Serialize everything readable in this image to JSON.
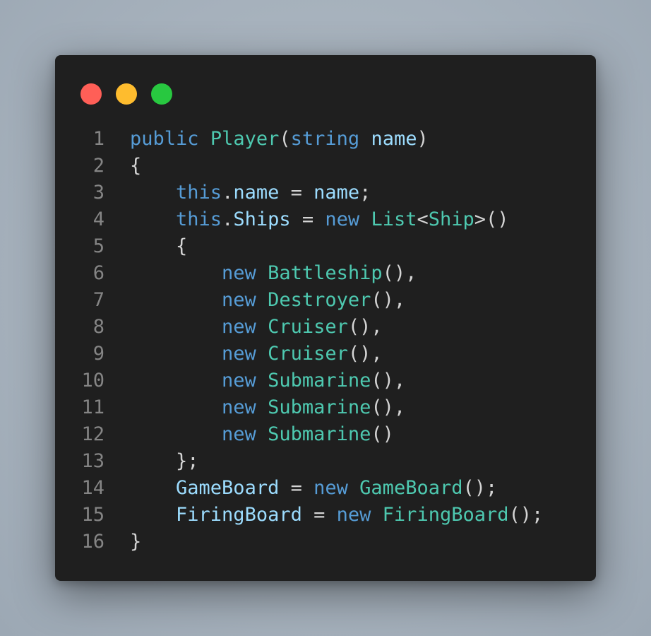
{
  "window": {
    "controls": [
      {
        "name": "close",
        "color": "#ff5f57"
      },
      {
        "name": "minimize",
        "color": "#febc2e"
      },
      {
        "name": "maximize",
        "color": "#28c840"
      }
    ]
  },
  "theme": {
    "background": "#1f1f1f",
    "keyword": "#569cd6",
    "type": "#4ec9b0",
    "variable": "#9cdcfe",
    "punctuation": "#d4d4d4",
    "line_number": "#858585"
  },
  "code": {
    "language": "csharp",
    "lines": [
      {
        "num": "1",
        "tokens": [
          [
            "keyword",
            "public"
          ],
          [
            "punct",
            " "
          ],
          [
            "type",
            "Player"
          ],
          [
            "punct",
            "("
          ],
          [
            "keyword",
            "string"
          ],
          [
            "punct",
            " "
          ],
          [
            "variable",
            "name"
          ],
          [
            "punct",
            ")"
          ]
        ]
      },
      {
        "num": "2",
        "tokens": [
          [
            "punct",
            "{"
          ]
        ]
      },
      {
        "num": "3",
        "tokens": [
          [
            "punct",
            "    "
          ],
          [
            "keyword",
            "this"
          ],
          [
            "punct",
            "."
          ],
          [
            "variable",
            "name"
          ],
          [
            "punct",
            " = "
          ],
          [
            "variable",
            "name"
          ],
          [
            "punct",
            ";"
          ]
        ]
      },
      {
        "num": "4",
        "tokens": [
          [
            "punct",
            "    "
          ],
          [
            "keyword",
            "this"
          ],
          [
            "punct",
            "."
          ],
          [
            "variable",
            "Ships"
          ],
          [
            "punct",
            " = "
          ],
          [
            "keyword",
            "new"
          ],
          [
            "punct",
            " "
          ],
          [
            "type",
            "List"
          ],
          [
            "punct",
            "<"
          ],
          [
            "type",
            "Ship"
          ],
          [
            "punct",
            ">()"
          ]
        ]
      },
      {
        "num": "5",
        "tokens": [
          [
            "punct",
            "    {"
          ]
        ]
      },
      {
        "num": "6",
        "tokens": [
          [
            "punct",
            "        "
          ],
          [
            "keyword",
            "new"
          ],
          [
            "punct",
            " "
          ],
          [
            "type",
            "Battleship"
          ],
          [
            "punct",
            "(),"
          ]
        ]
      },
      {
        "num": "7",
        "tokens": [
          [
            "punct",
            "        "
          ],
          [
            "keyword",
            "new"
          ],
          [
            "punct",
            " "
          ],
          [
            "type",
            "Destroyer"
          ],
          [
            "punct",
            "(),"
          ]
        ]
      },
      {
        "num": "8",
        "tokens": [
          [
            "punct",
            "        "
          ],
          [
            "keyword",
            "new"
          ],
          [
            "punct",
            " "
          ],
          [
            "type",
            "Cruiser"
          ],
          [
            "punct",
            "(),"
          ]
        ]
      },
      {
        "num": "9",
        "tokens": [
          [
            "punct",
            "        "
          ],
          [
            "keyword",
            "new"
          ],
          [
            "punct",
            " "
          ],
          [
            "type",
            "Cruiser"
          ],
          [
            "punct",
            "(),"
          ]
        ]
      },
      {
        "num": "10",
        "tokens": [
          [
            "punct",
            "        "
          ],
          [
            "keyword",
            "new"
          ],
          [
            "punct",
            " "
          ],
          [
            "type",
            "Submarine"
          ],
          [
            "punct",
            "(),"
          ]
        ]
      },
      {
        "num": "11",
        "tokens": [
          [
            "punct",
            "        "
          ],
          [
            "keyword",
            "new"
          ],
          [
            "punct",
            " "
          ],
          [
            "type",
            "Submarine"
          ],
          [
            "punct",
            "(),"
          ]
        ]
      },
      {
        "num": "12",
        "tokens": [
          [
            "punct",
            "        "
          ],
          [
            "keyword",
            "new"
          ],
          [
            "punct",
            " "
          ],
          [
            "type",
            "Submarine"
          ],
          [
            "punct",
            "()"
          ]
        ]
      },
      {
        "num": "13",
        "tokens": [
          [
            "punct",
            "    };"
          ]
        ]
      },
      {
        "num": "14",
        "tokens": [
          [
            "punct",
            "    "
          ],
          [
            "variable",
            "GameBoard"
          ],
          [
            "punct",
            " = "
          ],
          [
            "keyword",
            "new"
          ],
          [
            "punct",
            " "
          ],
          [
            "type",
            "GameBoard"
          ],
          [
            "punct",
            "();"
          ]
        ]
      },
      {
        "num": "15",
        "tokens": [
          [
            "punct",
            "    "
          ],
          [
            "variable",
            "FiringBoard"
          ],
          [
            "punct",
            " = "
          ],
          [
            "keyword",
            "new"
          ],
          [
            "punct",
            " "
          ],
          [
            "type",
            "FiringBoard"
          ],
          [
            "punct",
            "();"
          ]
        ]
      },
      {
        "num": "16",
        "tokens": [
          [
            "punct",
            "}"
          ]
        ]
      }
    ]
  }
}
